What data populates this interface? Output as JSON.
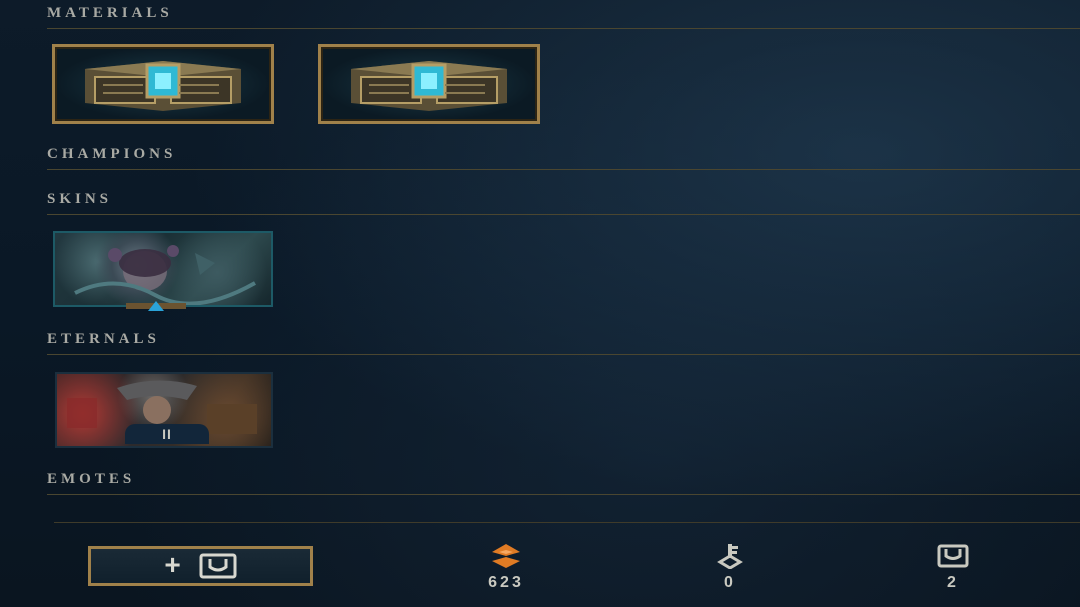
{
  "sections": {
    "materials": "MATERIALS",
    "champions": "CHAMPIONS",
    "skins": "SKINS",
    "eternals": "ETERNALS",
    "emotes": "EMOTES"
  },
  "materials": [
    {
      "icon": "hextech-chest-icon"
    },
    {
      "icon": "hextech-chest-icon"
    }
  ],
  "skins": [
    {
      "icon": "skin-shard-icon"
    }
  ],
  "eternals": [
    {
      "icon": "eternal-shard-icon",
      "badge": "II"
    }
  ],
  "footer": {
    "craft_button_icon": "chest-icon",
    "orange_essence": "623",
    "keys": "0",
    "chests": "2"
  },
  "colors": {
    "gold_border": "#a0814a",
    "orange_essence": "#e07b24",
    "text": "#a9aaa4"
  }
}
